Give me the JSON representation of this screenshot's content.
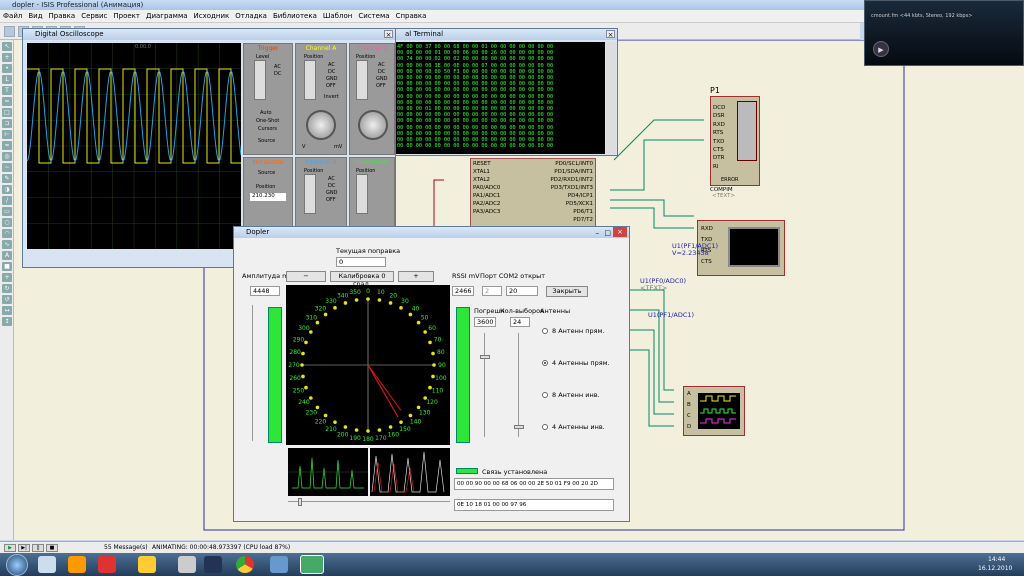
{
  "window": {
    "title": "dopler - ISIS Professional (Анимация)"
  },
  "menu": [
    "Файл",
    "Вид",
    "Правка",
    "Сервис",
    "Проект",
    "Диаграмма",
    "Исходник",
    "Отладка",
    "Библиотека",
    "Шаблон",
    "Система",
    "Справка"
  ],
  "oscilloscope": {
    "title": "Digital Oscilloscope",
    "trigger_label": "Trigger",
    "channel_a": "Channel A",
    "channel_b": "Channel B",
    "channel_c": "Channel C",
    "channel_d": "Channel D",
    "horizontal": "Horizontal",
    "level": "Level",
    "position": "Position",
    "ac": "AC",
    "dc": "DC",
    "gnd": "GND",
    "off": "OFF",
    "invert": "Invert",
    "auto": "Auto",
    "one_shot": "One-Shot",
    "cursors": "Cursors",
    "source": "Source",
    "mv": "mV",
    "v": "V",
    "pos_value": "210.230",
    "screen_label": "0.00.0"
  },
  "terminal": {
    "title": "al Terminal",
    "lines": [
      "4F 00 00 37 00 00 68 00 00 01 00 00 00 00 00 00 00",
      "00 00 00 00 01 00 00 06 00 00 26 00 00 00 00 00 00",
      "00 74 00 00 02 00 02 00 00 00 00 00 00 00 00 00 00",
      "00 00 00 00 3E 00 0E 00 00 07 00 00 00 00 00 00 00",
      "00 00 00 00 00 50 F3 00 00 00 00 00 00 00 00 00 00",
      "00 00 00 00 00 00 00 00 08 00 00 00 00 00 00 00 00",
      "00 00 00 00 00 00 00 00 00 00 00 00 00 00 00 00 00",
      "00 00 00 00 00 00 00 00 00 00 00 00 00 00 00 00 00",
      "00 00 00 00 00 00 00 00 00 00 00 00 00 00 00 00 00",
      "00 00 00 00 00 00 00 00 00 00 00 00 00 00 00 00 00",
      "00 00 00 01 00 00 00 00 00 00 00 00 00 00 00 00 00",
      "00 00 00 00 00 00 00 00 00 00 00 00 00 00 00 00 00",
      "00 00 00 00 00 00 00 00 00 00 00 00 00 00 00 00 00",
      "00 00 00 00 00 00 00 00 00 00 00 00 00 00 00 00 00",
      "00 00 00 00 00 00 00 00 00 00 00 00 00 00 00 00 00",
      "00 00 00 00 00 00 00 00 00 00 00 00 00 00 00 00 00",
      "00 00 00 00 00 00 00 00 00 00 00 00 00 00 00 00 00"
    ]
  },
  "mcu": {
    "left_pins": [
      "RESET",
      "XTAL1",
      "XTAL2",
      "PA0/ADC0",
      "PA1/ADC1",
      "PA2/ADC2",
      "PA3/ADC3"
    ],
    "right_pins": [
      "PD0/SCL/INT0",
      "PD1/SDA/INT1",
      "PD2/RXD1/INT2",
      "PD3/TXD1/INT3",
      "PD4/ICP1",
      "PD5/XCK1",
      "PD6/T1",
      "PD7/T2"
    ],
    "pin_nums_left": [
      "20",
      "24",
      "23",
      "61",
      "60",
      "59",
      "58"
    ],
    "pin_nums_right": [
      "25",
      "26",
      "27",
      "28",
      "29",
      "30",
      "31",
      "32"
    ]
  },
  "compim": {
    "ref": "P1",
    "pins": [
      "DCD",
      "DSR",
      "RXD",
      "RTS",
      "TXD",
      "CTS",
      "DTR",
      "RI"
    ],
    "label": "COMPIM",
    "text": "<TEXT>",
    "error": "ERROR"
  },
  "vterm": {
    "pins": [
      "RXD",
      "TXD",
      "RTS",
      "CTS"
    ],
    "probe1": "U1(PF1/ADC1)",
    "probe1_value": "V=2.23438",
    "probe_text": "<TEXT>",
    "probe2": "U1(PF0/ADC0)",
    "probe3": "U1(PF1/ADC1)"
  },
  "scope_small": {
    "pins": [
      "A",
      "B",
      "C",
      "D"
    ]
  },
  "dopler": {
    "title": "Dopler",
    "current_correction_label": "Текущая поправка",
    "current_correction_value": "0",
    "amplitude_label": "Амплитуда mV",
    "amplitude_value": "4448",
    "minus_button": "−",
    "calibrate_button": "Калибровка 0 град.",
    "plus_button": "+",
    "rssi_label": "RSSI mV",
    "rssi_value": "2466",
    "port_label": "Порт COM2 открыт",
    "port_select": "2",
    "baud_value": "20",
    "close_button": "Закрыть",
    "error_label": "Погрешн",
    "samples_label": "Кол-выборок",
    "error_value": "3600",
    "samples_value": "24",
    "antennas_label": "Антенны",
    "antenna_options": [
      "8 Антенн прям.",
      "4 Антенны прям.",
      "8 Антенн инв.",
      "4 Антенны инв."
    ],
    "antenna_selected": 1,
    "connection_status": "Связь установлена",
    "hex_line1": "00 00 90 00 00 68 06 00 00 2E 50 01 F9 00 20 2D",
    "hex_line2": "0E 10 18 01 00 00 97 96",
    "compass_ticks": [
      "0",
      "10",
      "20",
      "30",
      "40",
      "50",
      "60",
      "70",
      "80",
      "90",
      "100",
      "110",
      "120",
      "130",
      "140",
      "150",
      "160",
      "170",
      "180",
      "190",
      "200",
      "210",
      "220",
      "230",
      "240",
      "250",
      "260",
      "270",
      "280",
      "290",
      "300",
      "310",
      "320",
      "330",
      "340",
      "350"
    ],
    "needle_deg": 150,
    "amplitude_level": 0.97,
    "rssi_level": 0.97
  },
  "status": {
    "messages": "55 Message(s)",
    "animating": "ANIMATING: 00:00:48.973397 (CPU load 87%)"
  },
  "player": {
    "text": "cmount.fm <44 kbts, Stereo, 192 kbps>"
  },
  "clock": {
    "time": "14:44",
    "date": "16.12.2010"
  },
  "colors": {
    "bar_green": "#2ee63a",
    "scope_yellow": "#e6e617",
    "scope_cyan": "#2aa0e0",
    "needle": "#d01818"
  }
}
